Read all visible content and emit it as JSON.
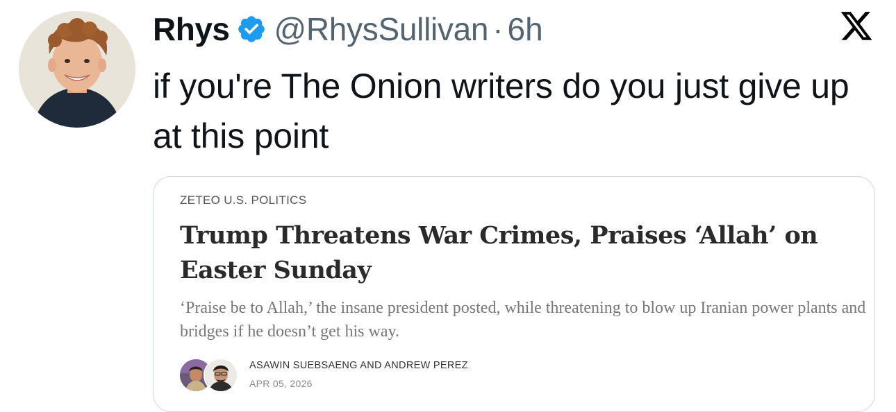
{
  "tweet": {
    "author": {
      "display_name": "Rhys",
      "handle": "@RhysSullivan",
      "verified": true,
      "avatar_icon": "profile-photo"
    },
    "separator": "·",
    "timestamp": "6h",
    "text": "if you're The Onion writers do you just give up at this point",
    "platform_icon": "x-logo-icon"
  },
  "link_card": {
    "section": "ZETEO U.S. POLITICS",
    "headline": "Trump Threatens War Crimes, Praises ‘Allah’ on Easter Sunday",
    "dek": "‘Praise be to Allah,’ the insane president posted, while threatening to blow up Iranian power plants and bridges if he doesn’t get his way.",
    "byline": {
      "authors": "ASAWIN SUEBSAENG AND ANDREW PEREZ",
      "date": "APR 05, 2026"
    }
  },
  "colors": {
    "text_primary": "#0f1419",
    "text_secondary": "#536471",
    "verified_blue": "#1d9bf0",
    "card_border": "#cfd9de"
  }
}
